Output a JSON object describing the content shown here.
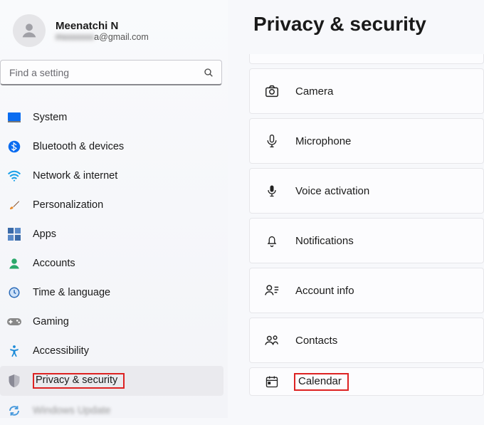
{
  "profile": {
    "name": "Meenatchi N",
    "email_visible_suffix": "a@gmail.com",
    "email_blurred_prefix": "mxxxxxxx"
  },
  "search": {
    "placeholder": "Find a setting"
  },
  "sidebar": {
    "items": [
      {
        "label": "System",
        "icon": "system"
      },
      {
        "label": "Bluetooth & devices",
        "icon": "bluetooth"
      },
      {
        "label": "Network & internet",
        "icon": "wifi"
      },
      {
        "label": "Personalization",
        "icon": "brush"
      },
      {
        "label": "Apps",
        "icon": "apps"
      },
      {
        "label": "Accounts",
        "icon": "account"
      },
      {
        "label": "Time & language",
        "icon": "time"
      },
      {
        "label": "Gaming",
        "icon": "gaming"
      },
      {
        "label": "Accessibility",
        "icon": "accessibility"
      },
      {
        "label": "Privacy & security",
        "icon": "shield",
        "selected": true,
        "highlighted": true
      },
      {
        "label": "",
        "icon": "update",
        "cut": true
      }
    ]
  },
  "page": {
    "title": "Privacy & security",
    "cards": [
      {
        "label": "Camera",
        "icon": "camera"
      },
      {
        "label": "Microphone",
        "icon": "mic"
      },
      {
        "label": "Voice activation",
        "icon": "voice"
      },
      {
        "label": "Notifications",
        "icon": "bell"
      },
      {
        "label": "Account info",
        "icon": "acct"
      },
      {
        "label": "Contacts",
        "icon": "contacts"
      },
      {
        "label": "Calendar",
        "icon": "calendar",
        "highlighted": true
      }
    ]
  }
}
